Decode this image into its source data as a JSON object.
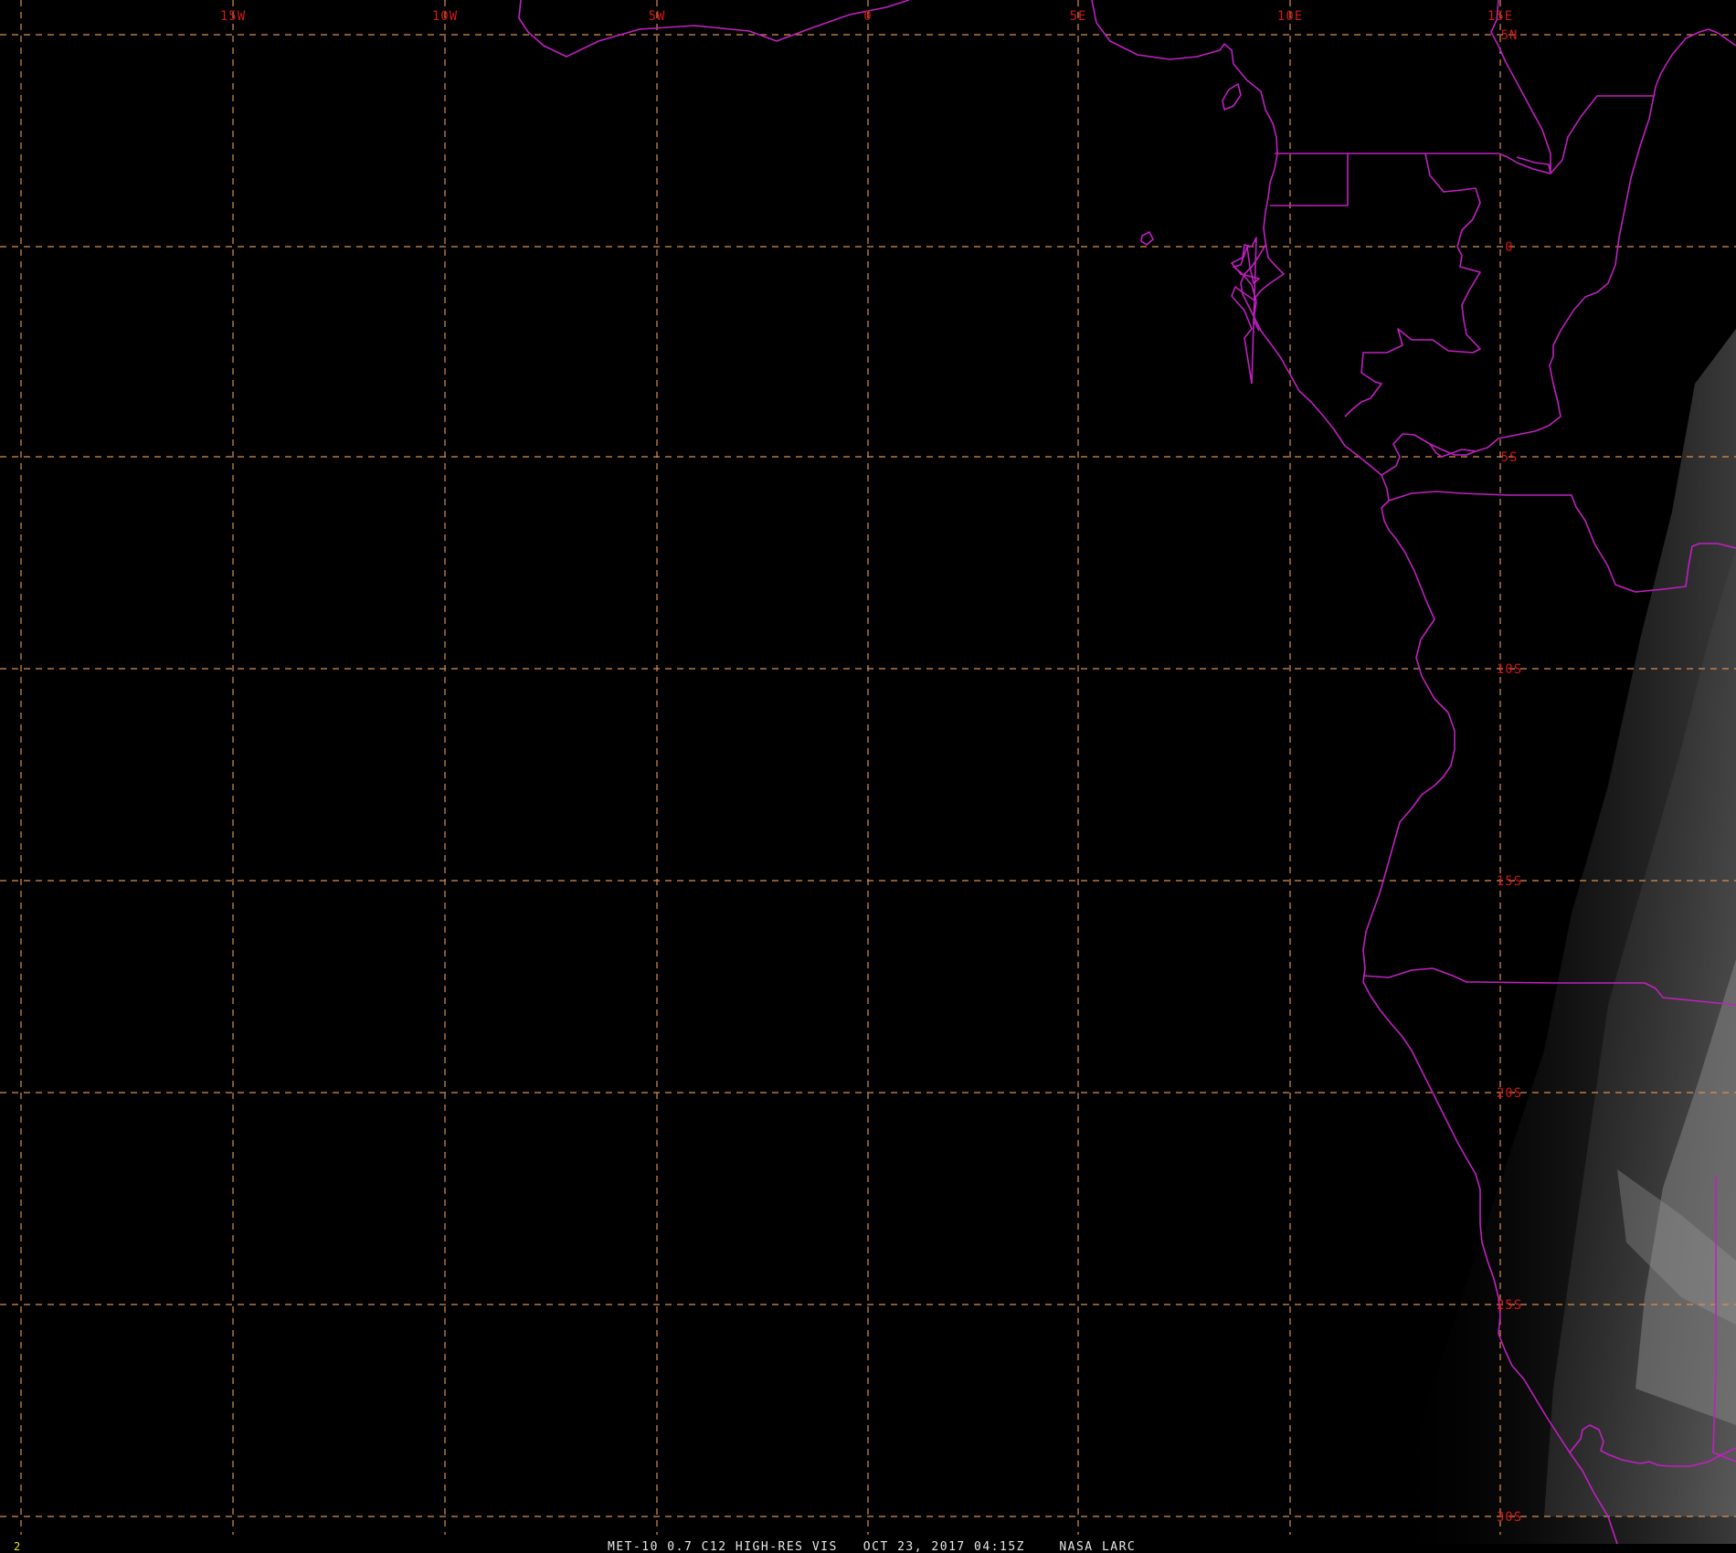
{
  "map": {
    "caption": "MET-10 0.7 C12 HIGH-RES VIS   OCT 23, 2017 04:15Z    NASA LARC",
    "frame_number": "2",
    "lon_labels": [
      "15W",
      "10W",
      "5W",
      "0",
      "5E",
      "10E",
      "15E"
    ],
    "lat_labels": [
      "5N",
      "0",
      "5S",
      "10S",
      "15S",
      "20S",
      "25S",
      "30S"
    ],
    "colors": {
      "background": "#000000",
      "grid": "#d89050",
      "coastline": "#c020c0",
      "labels": "#d01818",
      "caption": "#e8e8e8",
      "frame_number": "#e8e800"
    }
  }
}
